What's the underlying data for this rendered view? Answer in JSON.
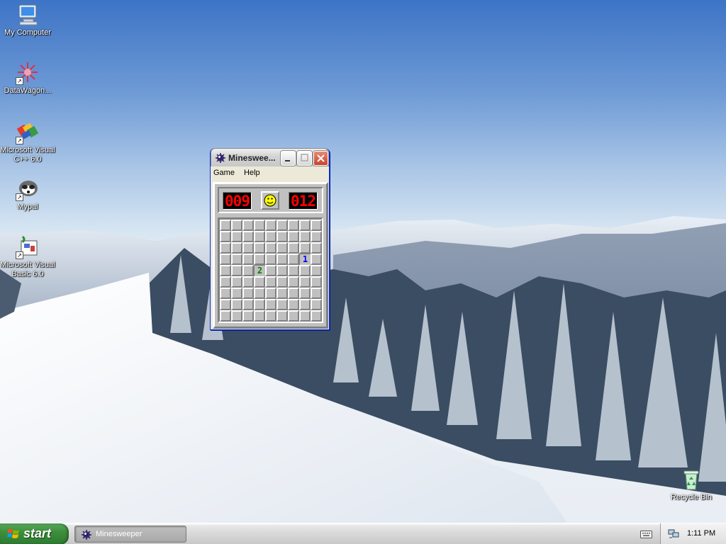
{
  "desktop": {
    "icons": [
      {
        "label": "My Computer",
        "icon": "my-computer-icon"
      },
      {
        "label": "DataWagon...",
        "icon": "datawagon-icon"
      },
      {
        "label": "Microsoft Visual C++ 6.0",
        "icon": "visual-cpp-icon"
      },
      {
        "label": "Mypal",
        "icon": "mypal-icon"
      },
      {
        "label": "Microsoft Visual Basic 6.0",
        "icon": "visual-basic-icon"
      },
      {
        "label": "Recycle Bin",
        "icon": "recycle-bin-icon"
      }
    ],
    "shortcut_arrow": "↗"
  },
  "window": {
    "title": "Minesweeper",
    "title_display": "Minesweе...",
    "menu": [
      "Game",
      "Help"
    ],
    "mines_counter": "009",
    "timer": "012",
    "grid": [
      [
        "",
        "",
        "",
        "",
        "",
        "",
        "",
        "",
        ""
      ],
      [
        "",
        "",
        "",
        "",
        "",
        "",
        "",
        "",
        ""
      ],
      [
        "",
        "",
        "",
        "",
        "",
        "",
        "",
        "",
        ""
      ],
      [
        "",
        "",
        "",
        "",
        "",
        "",
        "",
        "1",
        ""
      ],
      [
        "",
        "",
        "",
        "2",
        "",
        "",
        "",
        "",
        ""
      ],
      [
        "",
        "",
        "",
        "",
        "",
        "",
        "",
        "",
        ""
      ],
      [
        "",
        "",
        "",
        "",
        "",
        "",
        "",
        "",
        ""
      ],
      [
        "",
        "",
        "",
        "",
        "",
        "",
        "",
        "",
        ""
      ],
      [
        "",
        "",
        "",
        "",
        "",
        "",
        "",
        "",
        ""
      ]
    ]
  },
  "taskbar": {
    "start_label": "start",
    "tasks": [
      {
        "label": "Minesweeper",
        "icon": "minesweeper-icon"
      }
    ],
    "clock": "1:11 PM"
  },
  "colors": {
    "titlebar_close": "#c8432a",
    "start_green": "#3c8f3c",
    "lcd_red": "#ff0000"
  }
}
